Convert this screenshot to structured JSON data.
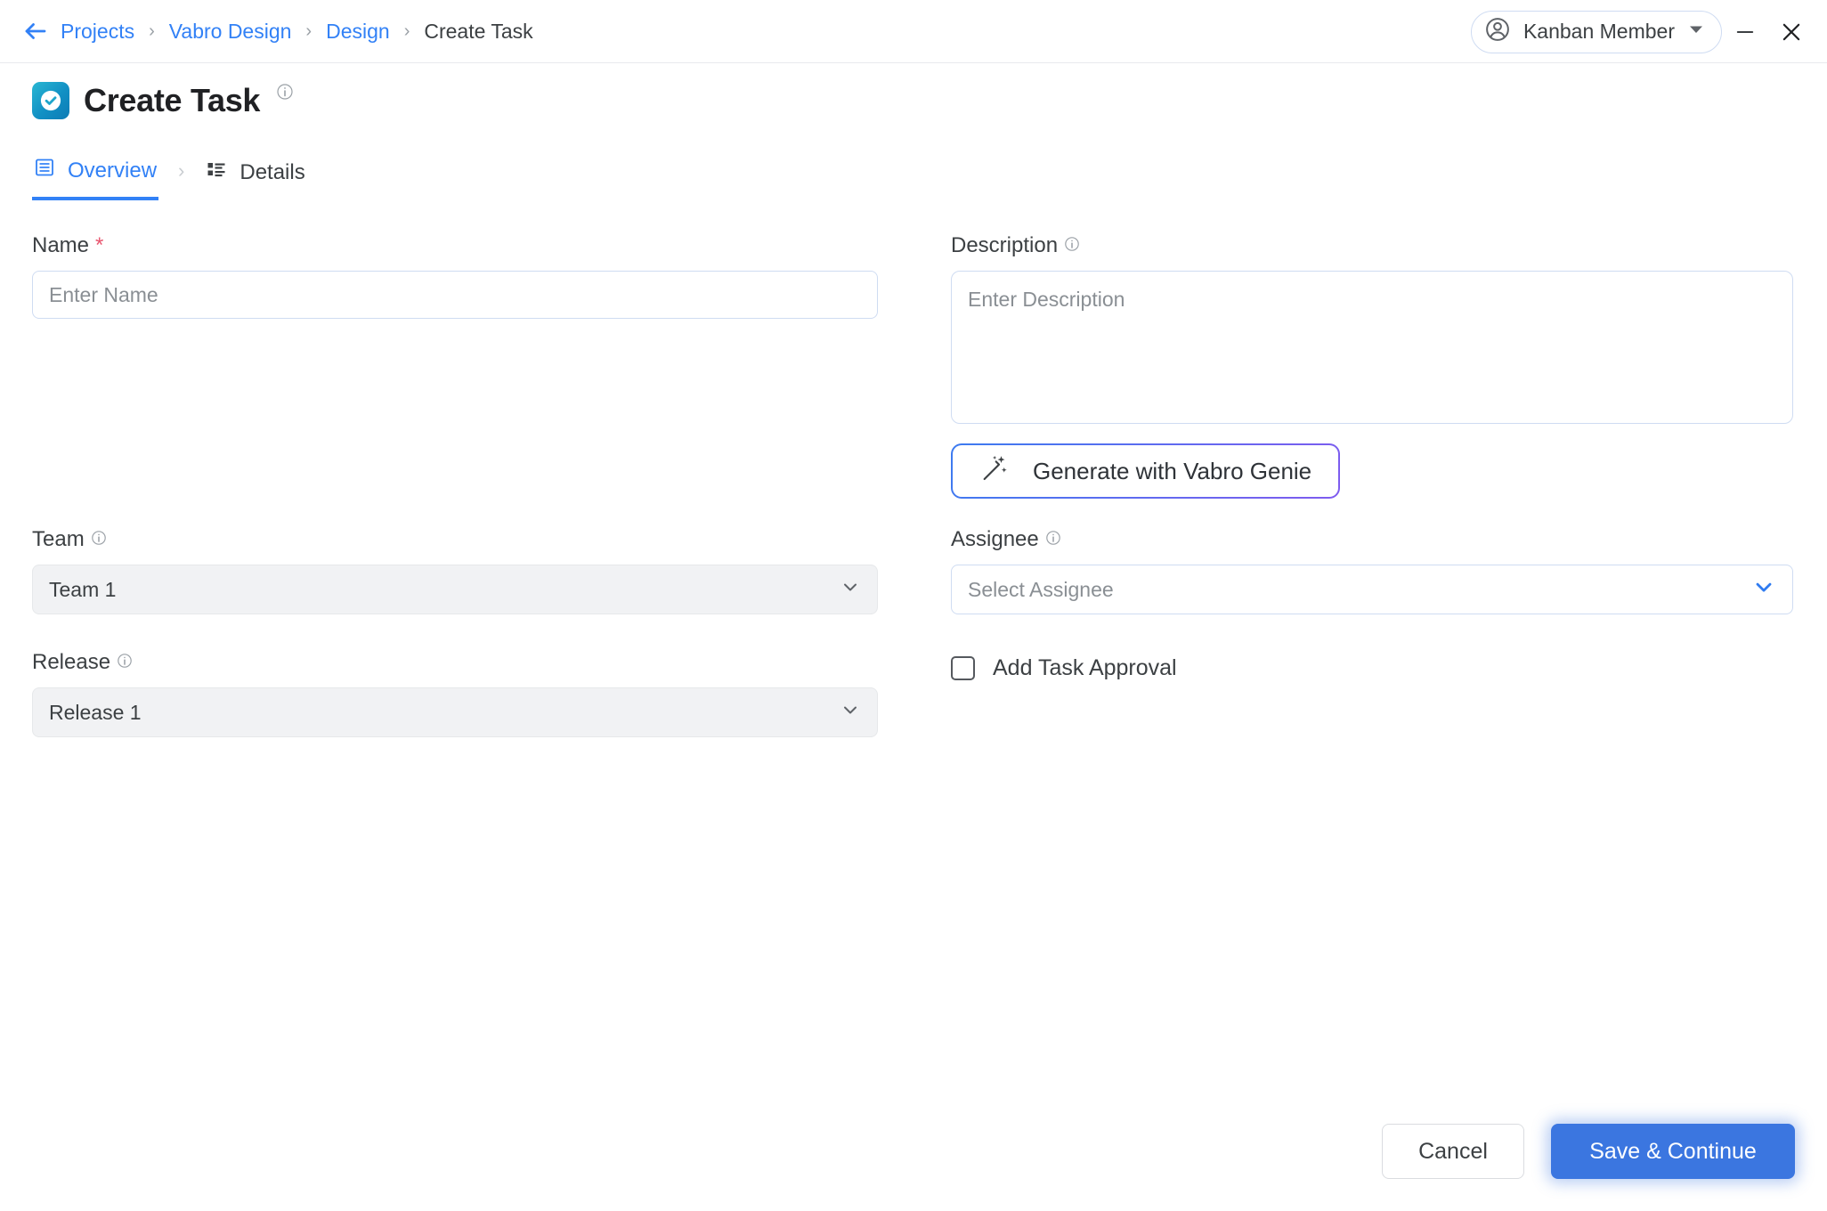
{
  "window": {
    "minimize_icon": "minimize-icon",
    "close_icon": "close-icon"
  },
  "breadcrumb": {
    "back_icon": "back-arrow-icon",
    "items": [
      {
        "label": "Projects",
        "current": false
      },
      {
        "label": "Vabro Design",
        "current": false
      },
      {
        "label": "Design",
        "current": false
      },
      {
        "label": "Create Task",
        "current": true
      }
    ],
    "separator": "›"
  },
  "user": {
    "name": "Kanban Member",
    "avatar_icon": "user-circle-icon",
    "caret_icon": "chevron-down-icon"
  },
  "header": {
    "title": "Create Task",
    "app_icon": "task-check-icon",
    "info_icon": "info-icon"
  },
  "tabs": [
    {
      "label": "Overview",
      "icon": "list-grid-icon",
      "active": true
    },
    {
      "label": "Details",
      "icon": "details-list-icon",
      "active": false
    }
  ],
  "tab_separator": "›",
  "form": {
    "name": {
      "label": "Name",
      "required_marker": "*",
      "placeholder": "Enter Name",
      "value": ""
    },
    "description": {
      "label": "Description",
      "placeholder": "Enter Description",
      "value": "",
      "info_icon": "info-icon"
    },
    "genie_button": {
      "label": "Generate with Vabro Genie",
      "icon": "magic-wand-icon"
    },
    "team": {
      "label": "Team",
      "value": "Team 1",
      "info_icon": "info-icon",
      "caret_icon": "chevron-down-icon"
    },
    "release": {
      "label": "Release",
      "value": "Release 1",
      "info_icon": "info-icon",
      "caret_icon": "chevron-down-icon"
    },
    "assignee": {
      "label": "Assignee",
      "placeholder": "Select Assignee",
      "value": "",
      "info_icon": "info-icon",
      "caret_icon": "chevron-down-icon"
    },
    "task_approval": {
      "label": "Add Task Approval",
      "checked": false
    }
  },
  "footer": {
    "cancel_label": "Cancel",
    "save_label": "Save & Continue"
  },
  "colors": {
    "accent_blue": "#3281f6",
    "primary_button": "#3b76e0",
    "required_red": "#e8566f",
    "app_icon_teal": "#1290c4",
    "field_border": "#cfdcf2",
    "grey_field_bg": "#f1f2f4"
  }
}
